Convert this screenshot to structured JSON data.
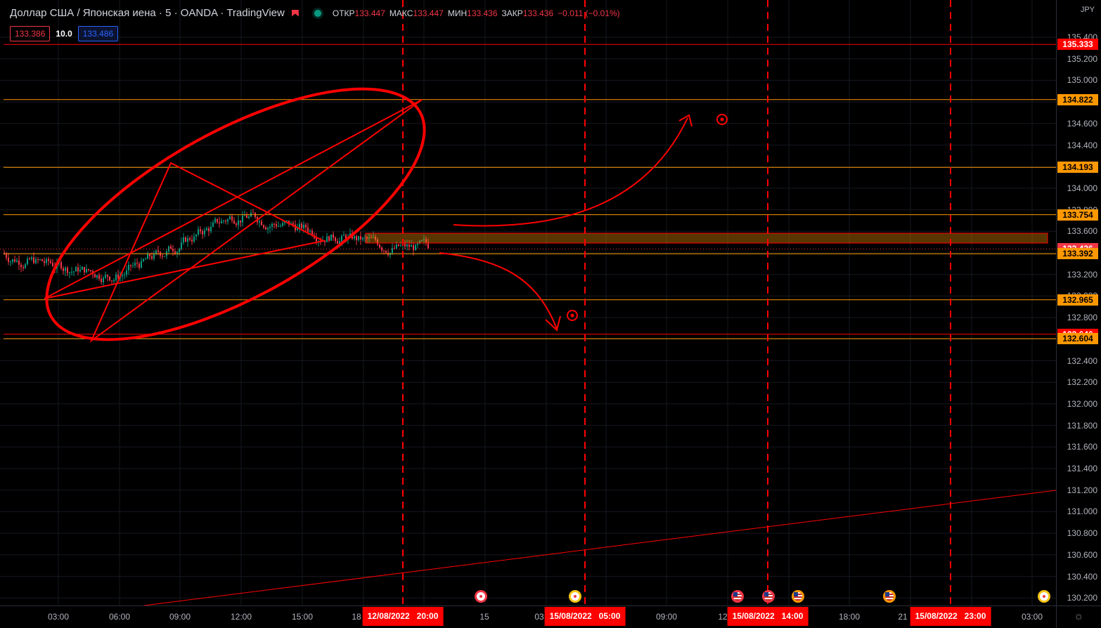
{
  "legend": {
    "symbol": "Доллар США / Японская иена · 5 · OANDA · TradingView",
    "open_label": "ОТКР",
    "open": "133.447",
    "high_label": "МАКС",
    "high": "133.447",
    "low_label": "МИН",
    "low": "133.436",
    "close_label": "ЗАКР",
    "close": "133.436",
    "change": "−0.011 (−0.01%)"
  },
  "quote": {
    "bid": "133.386",
    "spread": "10.0",
    "ask": "133.486"
  },
  "price_axis": {
    "currency": "JPY",
    "ticks": [
      "135.400",
      "135.200",
      "135.000",
      "134.800",
      "134.600",
      "134.400",
      "134.200",
      "134.000",
      "133.800",
      "133.600",
      "133.400",
      "133.200",
      "133.000",
      "132.800",
      "132.600",
      "132.400",
      "132.200",
      "132.000",
      "131.800",
      "131.600",
      "131.400",
      "131.200",
      "131.000",
      "130.800",
      "130.600",
      "130.400",
      "130.200"
    ],
    "labels": [
      {
        "text": "135.333",
        "price": 135.333,
        "bg": "#ff0000",
        "fg": "#ffffff"
      },
      {
        "text": "134.822",
        "price": 134.822,
        "bg": "#ff9800",
        "fg": "#000000"
      },
      {
        "text": "134.193",
        "price": 134.193,
        "bg": "#ff9800",
        "fg": "#000000"
      },
      {
        "text": "133.754",
        "price": 133.754,
        "bg": "#ff9800",
        "fg": "#000000"
      },
      {
        "text": "133.436",
        "price": 133.436,
        "bg": "#f23645",
        "fg": "#ffffff"
      },
      {
        "text": "133.392",
        "price": 133.392,
        "bg": "#ff9800",
        "fg": "#000000"
      },
      {
        "text": "132.965",
        "price": 132.965,
        "bg": "#ff9800",
        "fg": "#000000"
      },
      {
        "text": "132.646",
        "price": 132.646,
        "bg": "#ff0000",
        "fg": "#ffffff"
      },
      {
        "text": "132.604",
        "price": 132.604,
        "bg": "#ff9800",
        "fg": "#000000"
      }
    ]
  },
  "time_axis": {
    "ticks": [
      "03:00",
      "06:00",
      "09:00",
      "12:00",
      "15:00",
      "18",
      "15",
      "03",
      "09:00",
      "12",
      "18:00",
      "21",
      "03:00"
    ],
    "badges": [
      "12/08/2022   20:00",
      "15/08/2022   05:00",
      "15/08/2022   14:00",
      "15/08/2022   23:00"
    ]
  },
  "colors": {
    "background": "#000000",
    "red": "#ff0000",
    "orange": "#ff9800",
    "up": "#089981",
    "down": "#f23645"
  }
}
